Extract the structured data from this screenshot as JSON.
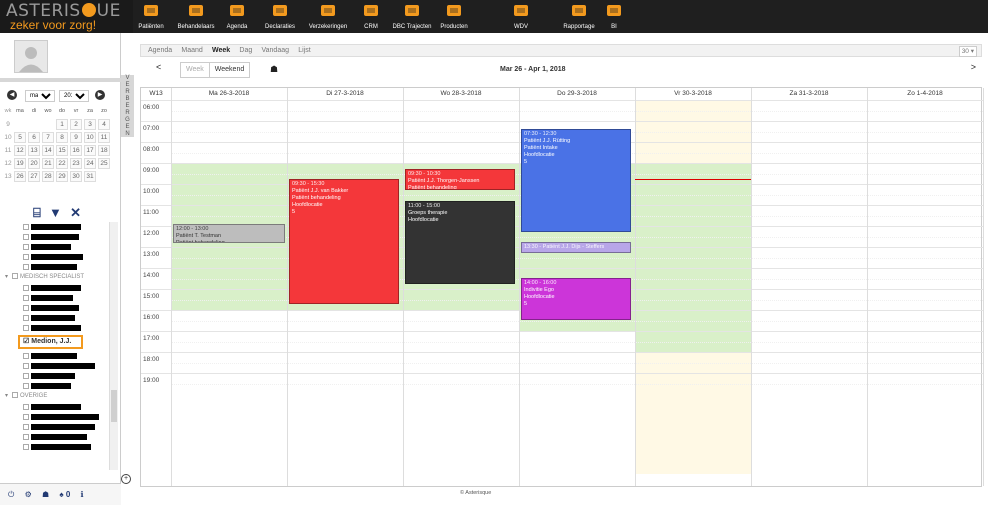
{
  "brand": {
    "name_left": "ASTERIS",
    "name_right": "UE",
    "tagline": "zeker voor zorg!",
    "accent": "#f39a1e"
  },
  "nav": [
    {
      "label": "Patiënten",
      "icon": "patients-icon"
    },
    {
      "label": "Behandelaars",
      "icon": "practitioners-icon"
    },
    {
      "label": "Agenda",
      "icon": "calendar-icon"
    },
    {
      "label": "Declaraties",
      "icon": "declarations-icon"
    },
    {
      "label": "Verzekeringen",
      "icon": "insurance-icon"
    },
    {
      "label": "CRM",
      "icon": "crm-icon"
    },
    {
      "label": "DBC Trajecten",
      "icon": "dbc-icon"
    },
    {
      "label": "Producten",
      "icon": "products-icon"
    },
    {
      "label": "WDV",
      "icon": "upload-icon"
    },
    {
      "label": "Rapportage",
      "icon": "report-icon"
    },
    {
      "label": "BI",
      "icon": "bi-icon"
    }
  ],
  "minical": {
    "month": "maa",
    "year": "2018",
    "dayheaders": [
      "wk",
      "ma",
      "di",
      "wo",
      "do",
      "vr",
      "za",
      "zo"
    ],
    "weeks": [
      {
        "wk": "9",
        "days": [
          "",
          "",
          "",
          "1",
          "2",
          "3",
          "4"
        ]
      },
      {
        "wk": "10",
        "days": [
          "5",
          "6",
          "7",
          "8",
          "9",
          "10",
          "11"
        ]
      },
      {
        "wk": "11",
        "days": [
          "12",
          "13",
          "14",
          "15",
          "16",
          "17",
          "18"
        ]
      },
      {
        "wk": "12",
        "days": [
          "19",
          "20",
          "21",
          "22",
          "23",
          "24",
          "25"
        ]
      },
      {
        "wk": "13",
        "days": [
          "26",
          "27",
          "28",
          "29",
          "30",
          "31",
          ""
        ]
      }
    ]
  },
  "vtab": "V E R B E R G E N",
  "tree": {
    "group1": "MEDISCH SPECIALIST",
    "selected": "Medion, J.J.",
    "group2": "OVERIGE"
  },
  "bottom": {
    "notif_count": "0"
  },
  "views": {
    "agenda": "Agenda",
    "maand": "Maand",
    "week": "Week",
    "dag": "Dag",
    "vandaag": "Vandaag",
    "lijst": "Lijst",
    "zoom": "30 ▾"
  },
  "nav2": {
    "prev": "<",
    "next": ">",
    "week_btn": "Week",
    "weekend_btn": "Weekend",
    "range": "Mar 26 - Apr 1, 2018"
  },
  "grid": {
    "week_label": "W13",
    "days": [
      "Ma 26-3-2018",
      "Di 27-3-2018",
      "Wo 28-3-2018",
      "Do 29-3-2018",
      "Vr 30-3-2018",
      "Za 31-3-2018",
      "Zo 1-4-2018"
    ],
    "hours": [
      "06:00",
      "07:00",
      "08:00",
      "09:00",
      "10:00",
      "11:00",
      "12:00",
      "13:00",
      "14:00",
      "15:00",
      "16:00",
      "17:00",
      "18:00",
      "19:00"
    ]
  },
  "events": [
    {
      "id": "e1",
      "time": "12:00 - 13:00",
      "lines": [
        "Patiënt T. Testman",
        "Patiënt behandeling"
      ],
      "color": "#bdbdbd"
    },
    {
      "id": "e2",
      "time": "09:30 - 15:30",
      "lines": [
        "Patiënt J.J. van Bakker",
        "Patiënt behandeling",
        "Hoofdlocatie",
        "5"
      ],
      "color": "#f4373a"
    },
    {
      "id": "e3",
      "time": "09:30 - 10:30",
      "lines": [
        "Patiënt J.J. Thorgen-Janssen",
        "Patiënt behandeling"
      ],
      "color": "#f4373a"
    },
    {
      "id": "e4",
      "time": "11:00 - 15:00",
      "lines": [
        "Groeps therapie",
        "Hoofdlocatie"
      ],
      "color": "#333333"
    },
    {
      "id": "e5",
      "time": "07:30 - 12:30",
      "lines": [
        "Patiënt J.J. Rütting",
        "Patiënt Intake",
        "Hoofdlocatie",
        "5"
      ],
      "color": "#4a72e6"
    },
    {
      "id": "e6",
      "time": "13:30 - Patiënt J.J. Dijs - Steffers",
      "lines": [],
      "color": "#b8a6e8"
    },
    {
      "id": "e7",
      "time": "14:00 - 16:00",
      "lines": [
        "Indivitie Ego",
        "Hoofdlocatie",
        "5"
      ],
      "color": "#cc35d9"
    }
  ],
  "footer": "© Asterisque"
}
